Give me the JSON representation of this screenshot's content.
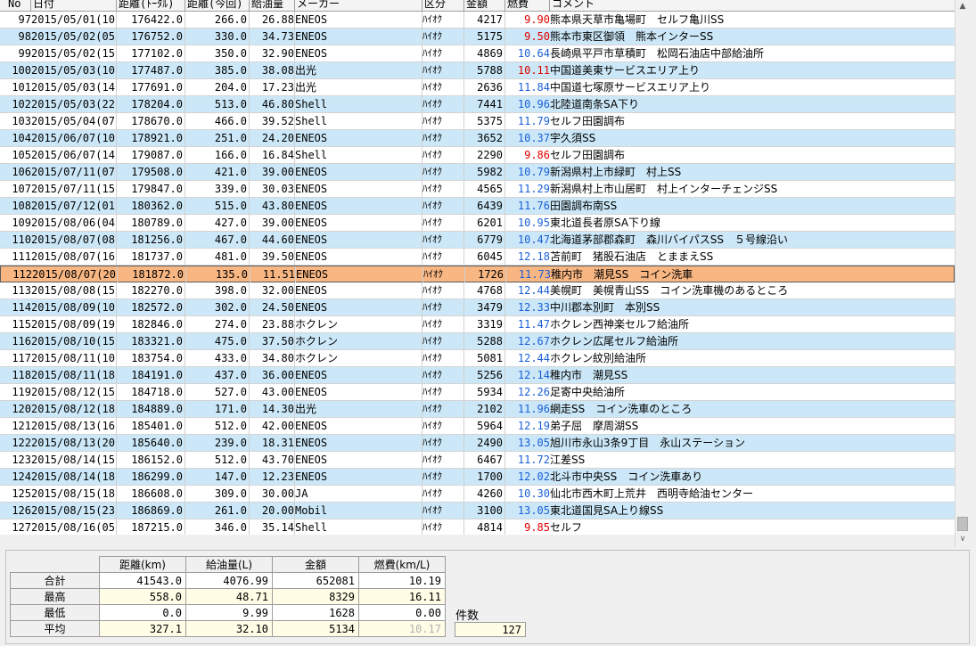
{
  "grid": {
    "headers": [
      "No",
      "日付",
      "距離(ﾄｰﾀﾙ)",
      "距離(今回)",
      "給油量",
      "メーカー",
      "区分",
      "金額",
      "燃費",
      "コメント"
    ],
    "rows": [
      {
        "no": "97",
        "date": "2015/05/01(10)",
        "odo": "176422.0",
        "dist": "266.0",
        "fuel": "26.88",
        "maker": "ENEOS",
        "kind": "ﾊｲｵｸ",
        "amount": "4217",
        "eff": "9.90",
        "eff_color": "red",
        "comment": "熊本県天草市亀場町　セルフ亀川SS"
      },
      {
        "no": "98",
        "date": "2015/05/02(05)",
        "odo": "176752.0",
        "dist": "330.0",
        "fuel": "34.73",
        "maker": "ENEOS",
        "kind": "ﾊｲｵｸ",
        "amount": "5175",
        "eff": "9.50",
        "eff_color": "red",
        "comment": "熊本市東区御領　熊本インターSS"
      },
      {
        "no": "99",
        "date": "2015/05/02(15)",
        "odo": "177102.0",
        "dist": "350.0",
        "fuel": "32.90",
        "maker": "ENEOS",
        "kind": "ﾊｲｵｸ",
        "amount": "4869",
        "eff": "10.64",
        "eff_color": "blue",
        "comment": "長崎県平戸市草積町　松岡石油店中部給油所"
      },
      {
        "no": "100",
        "date": "2015/05/03(10)",
        "odo": "177487.0",
        "dist": "385.0",
        "fuel": "38.08",
        "maker": "出光",
        "kind": "ﾊｲｵｸ",
        "amount": "5788",
        "eff": "10.11",
        "eff_color": "red",
        "comment": "中国道美東サービスエリア上り"
      },
      {
        "no": "101",
        "date": "2015/05/03(14)",
        "odo": "177691.0",
        "dist": "204.0",
        "fuel": "17.23",
        "maker": "出光",
        "kind": "ﾊｲｵｸ",
        "amount": "2636",
        "eff": "11.84",
        "eff_color": "blue",
        "comment": "中国道七塚原サービスエリア上り"
      },
      {
        "no": "102",
        "date": "2015/05/03(22)",
        "odo": "178204.0",
        "dist": "513.0",
        "fuel": "46.80",
        "maker": "Shell",
        "kind": "ﾊｲｵｸ",
        "amount": "7441",
        "eff": "10.96",
        "eff_color": "blue",
        "comment": "北陸道南条SA下り"
      },
      {
        "no": "103",
        "date": "2015/05/04(07)",
        "odo": "178670.0",
        "dist": "466.0",
        "fuel": "39.52",
        "maker": "Shell",
        "kind": "ﾊｲｵｸ",
        "amount": "5375",
        "eff": "11.79",
        "eff_color": "blue",
        "comment": "セルフ田園調布"
      },
      {
        "no": "104",
        "date": "2015/06/07(10)",
        "odo": "178921.0",
        "dist": "251.0",
        "fuel": "24.20",
        "maker": "ENEOS",
        "kind": "ﾊｲｵｸ",
        "amount": "3652",
        "eff": "10.37",
        "eff_color": "blue",
        "comment": "宇久須SS"
      },
      {
        "no": "105",
        "date": "2015/06/07(14)",
        "odo": "179087.0",
        "dist": "166.0",
        "fuel": "16.84",
        "maker": "Shell",
        "kind": "ﾊｲｵｸ",
        "amount": "2290",
        "eff": "9.86",
        "eff_color": "red",
        "comment": "セルフ田園調布"
      },
      {
        "no": "106",
        "date": "2015/07/11(07)",
        "odo": "179508.0",
        "dist": "421.0",
        "fuel": "39.00",
        "maker": "ENEOS",
        "kind": "ﾊｲｵｸ",
        "amount": "5982",
        "eff": "10.79",
        "eff_color": "blue",
        "comment": "新潟県村上市緑町　村上SS"
      },
      {
        "no": "107",
        "date": "2015/07/11(15)",
        "odo": "179847.0",
        "dist": "339.0",
        "fuel": "30.03",
        "maker": "ENEOS",
        "kind": "ﾊｲｵｸ",
        "amount": "4565",
        "eff": "11.29",
        "eff_color": "blue",
        "comment": "新潟県村上市山居町　村上インターチェンジSS"
      },
      {
        "no": "108",
        "date": "2015/07/12(01)",
        "odo": "180362.0",
        "dist": "515.0",
        "fuel": "43.80",
        "maker": "ENEOS",
        "kind": "ﾊｲｵｸ",
        "amount": "6439",
        "eff": "11.76",
        "eff_color": "blue",
        "comment": "田園調布南SS"
      },
      {
        "no": "109",
        "date": "2015/08/06(04)",
        "odo": "180789.0",
        "dist": "427.0",
        "fuel": "39.00",
        "maker": "ENEOS",
        "kind": "ﾊｲｵｸ",
        "amount": "6201",
        "eff": "10.95",
        "eff_color": "blue",
        "comment": "東北道長者原SA下り線"
      },
      {
        "no": "110",
        "date": "2015/08/07(08)",
        "odo": "181256.0",
        "dist": "467.0",
        "fuel": "44.60",
        "maker": "ENEOS",
        "kind": "ﾊｲｵｸ",
        "amount": "6779",
        "eff": "10.47",
        "eff_color": "blue",
        "comment": "北海道茅部郡森町　森川バイパスSS　５号線沿い"
      },
      {
        "no": "111",
        "date": "2015/08/07(16)",
        "odo": "181737.0",
        "dist": "481.0",
        "fuel": "39.50",
        "maker": "ENEOS",
        "kind": "ﾊｲｵｸ",
        "amount": "6045",
        "eff": "12.18",
        "eff_color": "blue",
        "comment": "苫前町　猪股石油店　とままえSS"
      },
      {
        "no": "112",
        "date": "2015/08/07(20)",
        "odo": "181872.0",
        "dist": "135.0",
        "fuel": "11.51",
        "maker": "ENEOS",
        "kind": "ﾊｲｵｸ",
        "amount": "1726",
        "eff": "11.73",
        "eff_color": "blue",
        "comment": "稚内市　潮見SS　コイン洗車",
        "selected": true
      },
      {
        "no": "113",
        "date": "2015/08/08(15)",
        "odo": "182270.0",
        "dist": "398.0",
        "fuel": "32.00",
        "maker": "ENEOS",
        "kind": "ﾊｲｵｸ",
        "amount": "4768",
        "eff": "12.44",
        "eff_color": "blue",
        "comment": "美幌町　美幌青山SS　コイン洗車機のあるところ"
      },
      {
        "no": "114",
        "date": "2015/08/09(10)",
        "odo": "182572.0",
        "dist": "302.0",
        "fuel": "24.50",
        "maker": "ENEOS",
        "kind": "ﾊｲｵｸ",
        "amount": "3479",
        "eff": "12.33",
        "eff_color": "blue",
        "comment": "中川郡本別町　本別SS"
      },
      {
        "no": "115",
        "date": "2015/08/09(19)",
        "odo": "182846.0",
        "dist": "274.0",
        "fuel": "23.88",
        "maker": "ホクレン",
        "kind": "ﾊｲｵｸ",
        "amount": "3319",
        "eff": "11.47",
        "eff_color": "blue",
        "comment": "ホクレン西神楽セルフ給油所"
      },
      {
        "no": "116",
        "date": "2015/08/10(15)",
        "odo": "183321.0",
        "dist": "475.0",
        "fuel": "37.50",
        "maker": "ホクレン",
        "kind": "ﾊｲｵｸ",
        "amount": "5288",
        "eff": "12.67",
        "eff_color": "blue",
        "comment": "ホクレン広尾セルフ給油所"
      },
      {
        "no": "117",
        "date": "2015/08/11(10)",
        "odo": "183754.0",
        "dist": "433.0",
        "fuel": "34.80",
        "maker": "ホクレン",
        "kind": "ﾊｲｵｸ",
        "amount": "5081",
        "eff": "12.44",
        "eff_color": "blue",
        "comment": "ホクレン紋別給油所"
      },
      {
        "no": "118",
        "date": "2015/08/11(18)",
        "odo": "184191.0",
        "dist": "437.0",
        "fuel": "36.00",
        "maker": "ENEOS",
        "kind": "ﾊｲｵｸ",
        "amount": "5256",
        "eff": "12.14",
        "eff_color": "blue",
        "comment": "稚内市　潮見SS"
      },
      {
        "no": "119",
        "date": "2015/08/12(15)",
        "odo": "184718.0",
        "dist": "527.0",
        "fuel": "43.00",
        "maker": "ENEOS",
        "kind": "ﾊｲｵｸ",
        "amount": "5934",
        "eff": "12.26",
        "eff_color": "blue",
        "comment": "足寄中央給油所"
      },
      {
        "no": "120",
        "date": "2015/08/12(18)",
        "odo": "184889.0",
        "dist": "171.0",
        "fuel": "14.30",
        "maker": "出光",
        "kind": "ﾊｲｵｸ",
        "amount": "2102",
        "eff": "11.96",
        "eff_color": "blue",
        "comment": "網走SS　コイン洗車のところ"
      },
      {
        "no": "121",
        "date": "2015/08/13(16)",
        "odo": "185401.0",
        "dist": "512.0",
        "fuel": "42.00",
        "maker": "ENEOS",
        "kind": "ﾊｲｵｸ",
        "amount": "5964",
        "eff": "12.19",
        "eff_color": "blue",
        "comment": "弟子屈　摩周湖SS"
      },
      {
        "no": "122",
        "date": "2015/08/13(20)",
        "odo": "185640.0",
        "dist": "239.0",
        "fuel": "18.31",
        "maker": "ENEOS",
        "kind": "ﾊｲｵｸ",
        "amount": "2490",
        "eff": "13.05",
        "eff_color": "blue",
        "comment": "旭川市永山3条9丁目　永山ステーション"
      },
      {
        "no": "123",
        "date": "2015/08/14(15)",
        "odo": "186152.0",
        "dist": "512.0",
        "fuel": "43.70",
        "maker": "ENEOS",
        "kind": "ﾊｲｵｸ",
        "amount": "6467",
        "eff": "11.72",
        "eff_color": "blue",
        "comment": "江差SS"
      },
      {
        "no": "124",
        "date": "2015/08/14(18)",
        "odo": "186299.0",
        "dist": "147.0",
        "fuel": "12.23",
        "maker": "ENEOS",
        "kind": "ﾊｲｵｸ",
        "amount": "1700",
        "eff": "12.02",
        "eff_color": "blue",
        "comment": "北斗市中央SS　コイン洗車あり"
      },
      {
        "no": "125",
        "date": "2015/08/15(18)",
        "odo": "186608.0",
        "dist": "309.0",
        "fuel": "30.00",
        "maker": "JA",
        "kind": "ﾊｲｵｸ",
        "amount": "4260",
        "eff": "10.30",
        "eff_color": "blue",
        "comment": "仙北市西木町上荒井　西明寺給油センター"
      },
      {
        "no": "126",
        "date": "2015/08/15(23)",
        "odo": "186869.0",
        "dist": "261.0",
        "fuel": "20.00",
        "maker": "Mobil",
        "kind": "ﾊｲｵｸ",
        "amount": "3100",
        "eff": "13.05",
        "eff_color": "blue",
        "comment": "東北道国見SA上り線SS"
      },
      {
        "no": "127",
        "date": "2015/08/16(05)",
        "odo": "187215.0",
        "dist": "346.0",
        "fuel": "35.14",
        "maker": "Shell",
        "kind": "ﾊｲｵｸ",
        "amount": "4814",
        "eff": "9.85",
        "eff_color": "red",
        "comment": "セルフ"
      }
    ]
  },
  "colors": {
    "row_odd": "#cce8f8",
    "row_selected": "#f8b682",
    "eff_red": "#e00000",
    "eff_blue": "#1a5fd8",
    "summary_highlight": "#fffde6"
  },
  "summary": {
    "headers": [
      "距離(km)",
      "給油量(L)",
      "金額",
      "燃費(km/L)"
    ],
    "rows": [
      {
        "label": "合計",
        "values": [
          "41543.0",
          "4076.99",
          "652081",
          "10.19"
        ]
      },
      {
        "label": "最高",
        "values": [
          "558.0",
          "48.71",
          "8329",
          "16.11"
        ]
      },
      {
        "label": "最低",
        "values": [
          "0.0",
          "9.99",
          "1628",
          "0.00"
        ]
      },
      {
        "label": "平均",
        "values": [
          "327.1",
          "32.10",
          "5134",
          "10.17"
        ]
      }
    ],
    "count_label": "件数",
    "count_value": "127"
  },
  "icons": {
    "scroll_up": "triangle-up-icon",
    "scroll_down": "chevron-down-icon"
  }
}
